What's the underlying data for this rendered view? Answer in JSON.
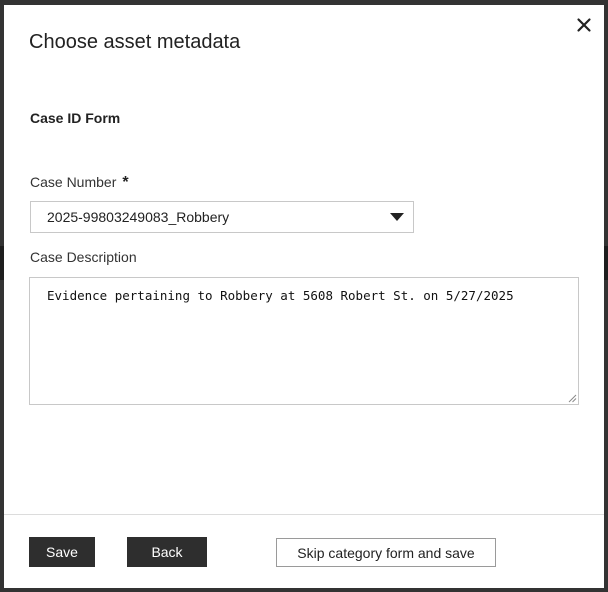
{
  "dialog": {
    "title": "Choose asset metadata",
    "close_icon": "close-icon"
  },
  "form": {
    "title": "Case ID Form",
    "case_number": {
      "label": "Case Number",
      "required_marker": "*",
      "selected_value": "2025-99803249083_Robbery",
      "dropdown_icon": "caret-down-icon"
    },
    "case_description": {
      "label": "Case Description",
      "value": "Evidence pertaining to Robbery at 5608 Robert St. on 5/27/2025"
    }
  },
  "footer": {
    "save_label": "Save",
    "back_label": "Back",
    "skip_label": "Skip category form and save"
  },
  "colors": {
    "primary_button": "#2e2e2e",
    "backdrop": "#333333",
    "border": "#c8c8c8"
  }
}
